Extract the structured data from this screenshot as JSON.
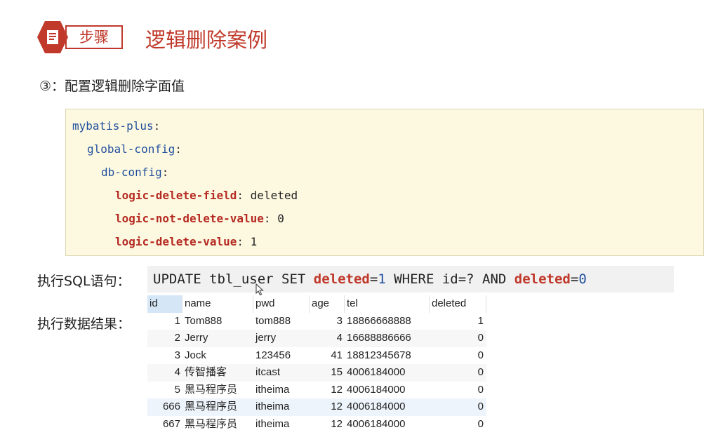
{
  "header": {
    "step_label": "步骤",
    "title": "逻辑删除案例"
  },
  "subtitle": "③：配置逻辑删除字面值",
  "code": {
    "l1": "mybatis-plus",
    "l2": "global-config",
    "l3": "db-config",
    "l4_key": "logic-delete-field",
    "l4_val": "deleted",
    "l5_key": "logic-not-delete-value",
    "l5_val": "0",
    "l6_key": "logic-delete-value",
    "l6_val": "1",
    "colon": ":"
  },
  "sql": {
    "label": "执行SQL语句：",
    "p1": "UPDATE tbl_user SET ",
    "p2": "deleted",
    "p3": "=",
    "p4": "1",
    "p5": " WHERE id=? AND ",
    "p6": "deleted",
    "p7": "=",
    "p8": "0"
  },
  "result": {
    "label": "执行数据结果：",
    "headers": [
      "id",
      "name",
      "pwd",
      "age",
      "tel",
      "deleted"
    ],
    "rows": [
      [
        "1",
        "Tom888",
        "tom888",
        "3",
        "18866668888",
        "1"
      ],
      [
        "2",
        "Jerry",
        "jerry",
        "4",
        "16688886666",
        "0"
      ],
      [
        "3",
        "Jock",
        "123456",
        "41",
        "18812345678",
        "0"
      ],
      [
        "4",
        "传智播客",
        "itcast",
        "15",
        "4006184000",
        "0"
      ],
      [
        "5",
        "黑马程序员",
        "itheima",
        "12",
        "4006184000",
        "0"
      ],
      [
        "666",
        "黑马程序员",
        "itheima",
        "12",
        "4006184000",
        "0"
      ],
      [
        "667",
        "黑马程序员",
        "itheima",
        "12",
        "4006184000",
        "0"
      ]
    ]
  },
  "colors": {
    "accent": "#c0392b",
    "code_bg": "#fdf9e1",
    "code_key": "#1f4e9c",
    "code_leaf": "#b52a22"
  }
}
